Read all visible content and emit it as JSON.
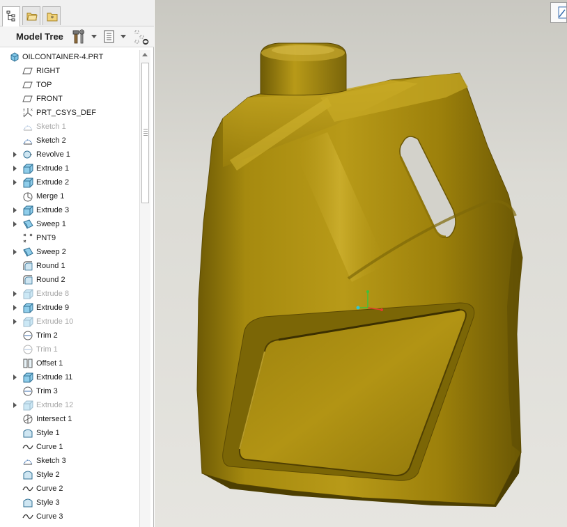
{
  "app": {
    "nav_tabs": [
      {
        "name": "model-tree-tab",
        "icon": "tree-icon",
        "active": true
      },
      {
        "name": "folder-browser-tab",
        "icon": "folder-icon",
        "active": false
      },
      {
        "name": "favorites-tab",
        "icon": "favorites-icon",
        "active": false
      }
    ]
  },
  "model_tree": {
    "title": "Model Tree",
    "settings_icon": "settings-tools-icon",
    "show_icon": "show-columns-icon",
    "filter_icon": "tree-filter-icon"
  },
  "tree": {
    "items": [
      {
        "label": "OILCONTAINER-4.PRT",
        "icon": "part-icon",
        "root": true,
        "expandable": false,
        "suppressed": false
      },
      {
        "label": "RIGHT",
        "icon": "datum-plane-icon",
        "expandable": false,
        "suppressed": false
      },
      {
        "label": "TOP",
        "icon": "datum-plane-icon",
        "expandable": false,
        "suppressed": false
      },
      {
        "label": "FRONT",
        "icon": "datum-plane-icon",
        "expandable": false,
        "suppressed": false
      },
      {
        "label": "PRT_CSYS_DEF",
        "icon": "csys-icon",
        "expandable": false,
        "suppressed": false
      },
      {
        "label": "Sketch 1",
        "icon": "sketch-icon",
        "expandable": false,
        "suppressed": true
      },
      {
        "label": "Sketch 2",
        "icon": "sketch-icon",
        "expandable": false,
        "suppressed": false
      },
      {
        "label": "Revolve 1",
        "icon": "revolve-icon",
        "expandable": true,
        "suppressed": false
      },
      {
        "label": "Extrude 1",
        "icon": "extrude-icon",
        "expandable": true,
        "suppressed": false
      },
      {
        "label": "Extrude 2",
        "icon": "extrude-icon",
        "expandable": true,
        "suppressed": false
      },
      {
        "label": "Merge 1",
        "icon": "merge-icon",
        "expandable": false,
        "suppressed": false
      },
      {
        "label": "Extrude 3",
        "icon": "extrude-icon",
        "expandable": true,
        "suppressed": false
      },
      {
        "label": "Sweep 1",
        "icon": "sweep-icon",
        "expandable": true,
        "suppressed": false
      },
      {
        "label": "PNT9",
        "icon": "datum-point-icon",
        "expandable": false,
        "suppressed": false
      },
      {
        "label": "Sweep 2",
        "icon": "sweep-icon",
        "expandable": true,
        "suppressed": false
      },
      {
        "label": "Round 1",
        "icon": "round-icon",
        "expandable": false,
        "suppressed": false
      },
      {
        "label": "Round 2",
        "icon": "round-icon",
        "expandable": false,
        "suppressed": false
      },
      {
        "label": "Extrude 8",
        "icon": "extrude-icon",
        "expandable": true,
        "suppressed": true
      },
      {
        "label": "Extrude 9",
        "icon": "extrude-icon",
        "expandable": true,
        "suppressed": false
      },
      {
        "label": "Extrude 10",
        "icon": "extrude-icon",
        "expandable": true,
        "suppressed": true
      },
      {
        "label": "Trim 2",
        "icon": "trim-icon",
        "expandable": false,
        "suppressed": false
      },
      {
        "label": "Trim 1",
        "icon": "trim-icon",
        "expandable": false,
        "suppressed": true
      },
      {
        "label": "Offset 1",
        "icon": "offset-icon",
        "expandable": false,
        "suppressed": false
      },
      {
        "label": "Extrude 11",
        "icon": "extrude-icon",
        "expandable": true,
        "suppressed": false
      },
      {
        "label": "Trim 3",
        "icon": "trim-icon",
        "expandable": false,
        "suppressed": false
      },
      {
        "label": "Extrude 12",
        "icon": "extrude-icon",
        "expandable": true,
        "suppressed": true
      },
      {
        "label": "Intersect 1",
        "icon": "intersect-icon",
        "expandable": false,
        "suppressed": false
      },
      {
        "label": "Style 1",
        "icon": "style-icon",
        "expandable": false,
        "suppressed": false
      },
      {
        "label": "Curve 1",
        "icon": "curve-icon",
        "expandable": false,
        "suppressed": false
      },
      {
        "label": "Sketch 3",
        "icon": "sketch-icon",
        "expandable": false,
        "suppressed": false
      },
      {
        "label": "Style 2",
        "icon": "style-icon",
        "expandable": false,
        "suppressed": false
      },
      {
        "label": "Curve 2",
        "icon": "curve-icon",
        "expandable": false,
        "suppressed": false
      },
      {
        "label": "Style 3",
        "icon": "style-icon",
        "expandable": false,
        "suppressed": false
      },
      {
        "label": "Curve 3",
        "icon": "curve-icon",
        "expandable": false,
        "suppressed": false
      }
    ]
  },
  "viewport": {
    "model": "oil-container-model",
    "model_color": "#a68a0f",
    "background_color": "#d9d8d2",
    "axis_colors": {
      "x": "#e23b2e",
      "y": "#3cc23c",
      "z": "#35c6d0"
    },
    "view_button_icon": "view-orientation-icon"
  }
}
